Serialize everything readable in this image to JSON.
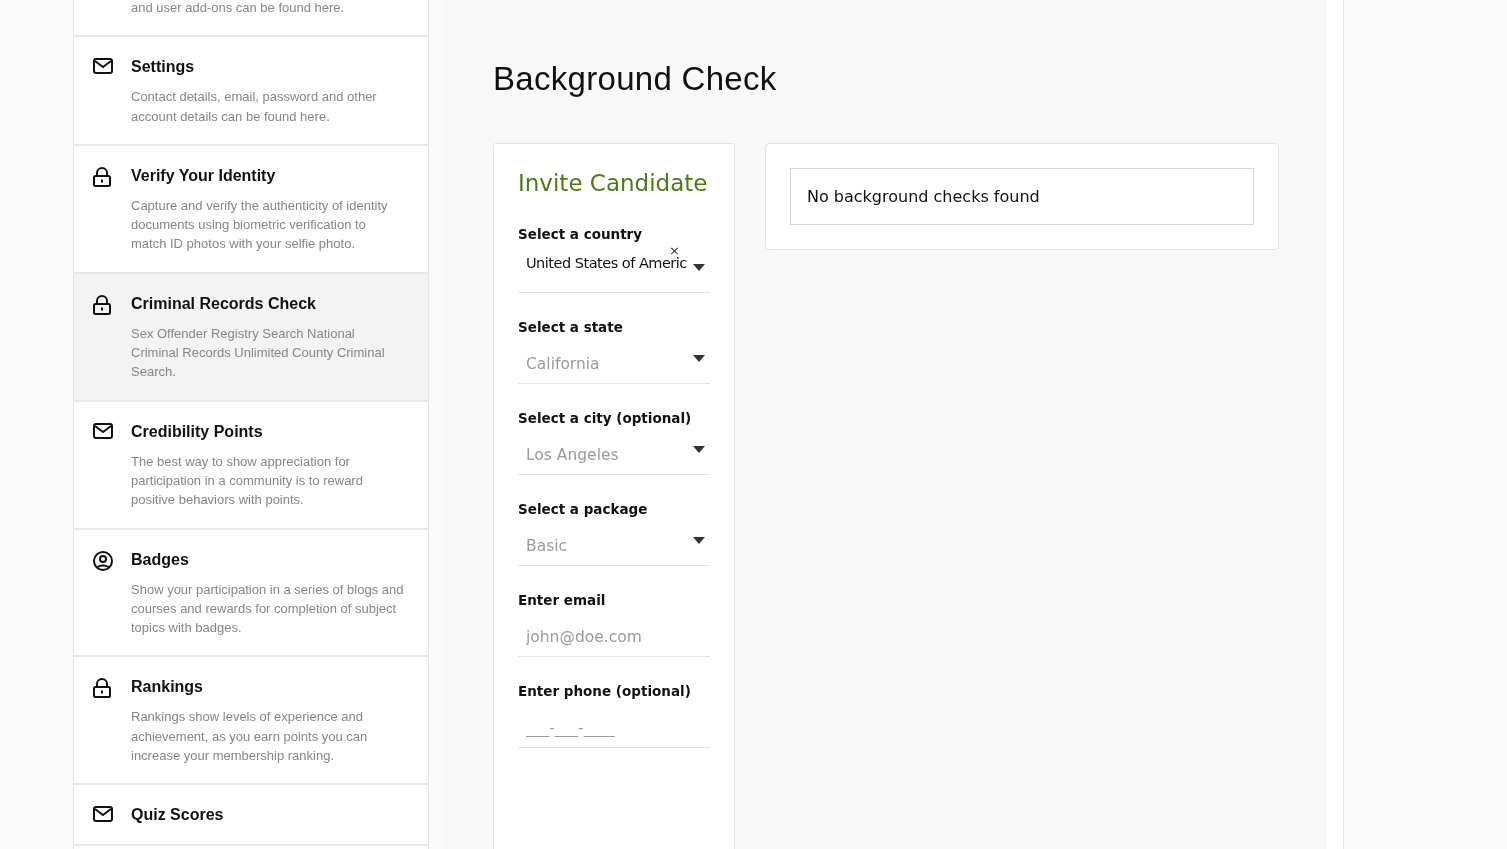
{
  "sidebar": {
    "items": [
      {
        "kind": "plain",
        "description": "and user add-ons can be found here.",
        "selected": false
      },
      {
        "kind": "mail",
        "title": "Settings",
        "description": "Contact details, email, password and other account details can be found here.",
        "selected": false
      },
      {
        "kind": "lock",
        "title": "Verify Your Identity",
        "description": "Capture and verify the authenticity of identity documents using biometric verification to match ID photos with your selfie photo.",
        "selected": false
      },
      {
        "kind": "lock",
        "title": "Criminal Records Check",
        "description": "Sex Offender Registry Search National Criminal Records Unlimited County Criminal Search.",
        "selected": true
      },
      {
        "kind": "mail",
        "title": "Credibility Points",
        "description": "The best way to show appreciation for participation in a community is to reward positive behaviors with points.",
        "selected": false
      },
      {
        "kind": "user",
        "title": "Badges",
        "description": "Show your participation in a series of blogs and courses and rewards for completion of subject topics with badges.",
        "selected": false
      },
      {
        "kind": "lock",
        "title": "Rankings",
        "description": "Rankings show levels of experience and achievement, as you earn points you can increase your membership ranking.",
        "selected": false
      },
      {
        "kind": "mail",
        "title": "Quiz Scores",
        "selected": false
      }
    ]
  },
  "main": {
    "title": "Background Check",
    "invite_form": {
      "title": "Invite Candidate",
      "fields": [
        {
          "kind": "select",
          "label": "Select a country",
          "value": "United States of Americ",
          "clear_label": "×"
        },
        {
          "kind": "select",
          "label": "Select a state",
          "placeholder": "California"
        },
        {
          "kind": "select",
          "label": "Select a city (optional)",
          "placeholder": "Los Angeles"
        },
        {
          "kind": "select",
          "label": "Select a package",
          "placeholder": "Basic"
        },
        {
          "kind": "input",
          "label": "Enter email",
          "placeholder": "john@doe.com"
        },
        {
          "kind": "input",
          "label": "Enter phone (optional)",
          "placeholder": "___-___-____"
        }
      ]
    },
    "results": {
      "empty_message": "No background checks found"
    }
  }
}
